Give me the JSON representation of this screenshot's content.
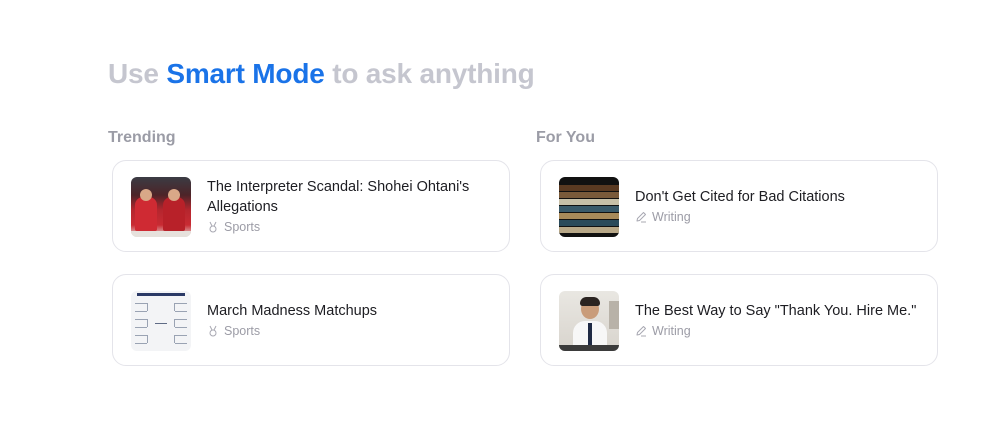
{
  "headline": {
    "prefix": "Use",
    "accent": "Smart Mode",
    "suffix": "to ask anything"
  },
  "colors": {
    "accent": "#1a73e8",
    "muted_heading": "#c5c6cf",
    "section_title": "#9b9ca6",
    "card_border": "#e4e4ea"
  },
  "trending": {
    "title": "Trending",
    "cards": [
      {
        "title": "The Interpreter Scandal: Shohei Ohtani's Allegations",
        "tag": "Sports",
        "tag_icon": "medal-icon",
        "thumbnail": "baseball-players-thumbnail"
      },
      {
        "title": "March Madness Matchups",
        "tag": "Sports",
        "tag_icon": "medal-icon",
        "thumbnail": "tournament-bracket-thumbnail"
      }
    ]
  },
  "for_you": {
    "title": "For You",
    "cards": [
      {
        "title": "Don't Get Cited for Bad Citations",
        "tag": "Writing",
        "tag_icon": "pencil-icon",
        "thumbnail": "stacked-books-thumbnail"
      },
      {
        "title": "The Best Way to Say \"Thank You. Hire Me.\"",
        "tag": "Writing",
        "tag_icon": "pencil-icon",
        "thumbnail": "businessman-thumbnail"
      }
    ]
  }
}
